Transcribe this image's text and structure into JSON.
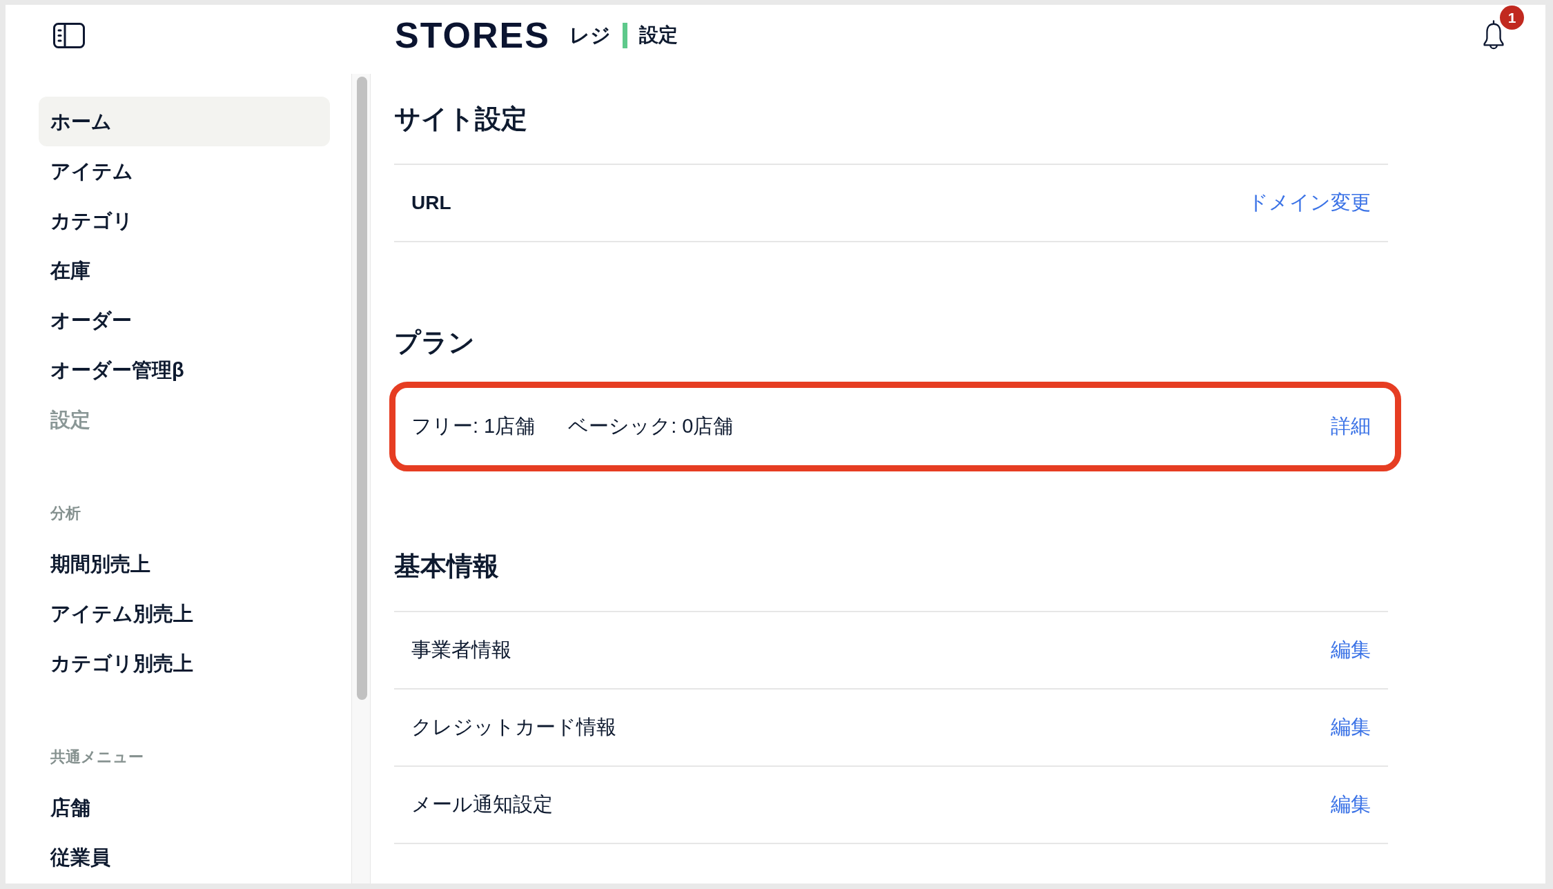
{
  "header": {
    "logo": "STORES",
    "product": "レジ",
    "page": "設定",
    "notification_count": "1"
  },
  "sidebar": {
    "groups": [
      {
        "items": [
          {
            "label": "ホーム",
            "selected": true,
            "disabled": false
          },
          {
            "label": "アイテム",
            "selected": false,
            "disabled": false
          },
          {
            "label": "カテゴリ",
            "selected": false,
            "disabled": false
          },
          {
            "label": "在庫",
            "selected": false,
            "disabled": false
          },
          {
            "label": "オーダー",
            "selected": false,
            "disabled": false
          },
          {
            "label": "オーダー管理β",
            "selected": false,
            "disabled": false
          },
          {
            "label": "設定",
            "selected": false,
            "disabled": true
          }
        ]
      },
      {
        "heading": "分析",
        "items": [
          {
            "label": "期間別売上",
            "selected": false,
            "disabled": false
          },
          {
            "label": "アイテム別売上",
            "selected": false,
            "disabled": false
          },
          {
            "label": "カテゴリ別売上",
            "selected": false,
            "disabled": false
          }
        ]
      },
      {
        "heading": "共通メニュー",
        "items": [
          {
            "label": "店舗",
            "selected": false,
            "disabled": false
          },
          {
            "label": "従業員",
            "selected": false,
            "disabled": false
          }
        ]
      }
    ]
  },
  "sections": [
    {
      "title": "サイト設定",
      "rows": [
        {
          "kind": "key",
          "label": "URL",
          "action": "ドメイン変更",
          "highlighted": false
        }
      ]
    },
    {
      "title": "プラン",
      "rows": [
        {
          "kind": "plan",
          "values": [
            "フリー: 1店舗",
            "ベーシック: 0店舗"
          ],
          "action": "詳細",
          "highlighted": true
        }
      ]
    },
    {
      "title": "基本情報",
      "rows": [
        {
          "kind": "plain",
          "label": "事業者情報",
          "action": "編集",
          "highlighted": false
        },
        {
          "kind": "plain",
          "label": "クレジットカード情報",
          "action": "編集",
          "highlighted": false
        },
        {
          "kind": "plain",
          "label": "メール通知設定",
          "action": "編集",
          "highlighted": false
        }
      ]
    }
  ]
}
